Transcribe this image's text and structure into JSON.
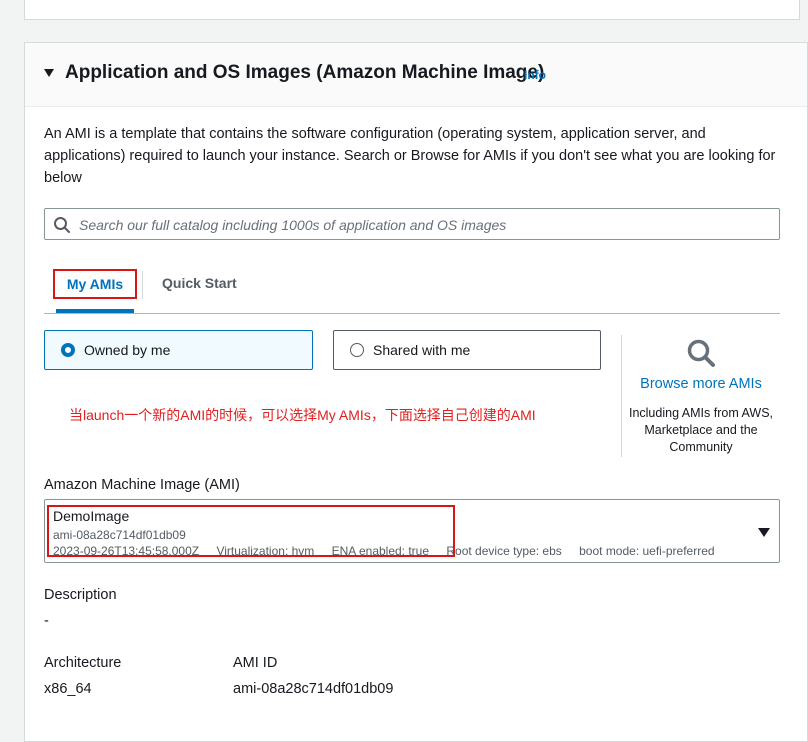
{
  "section": {
    "title": "Application and OS Images (Amazon Machine Image)",
    "info_link": "Info",
    "description": "An AMI is a template that contains the software configuration (operating system, application server, and applications) required to launch your instance. Search or Browse for AMIs if you don't see what you are looking for below"
  },
  "search": {
    "placeholder": "Search our full catalog including 1000s of application and OS images",
    "value": ""
  },
  "tabs": [
    {
      "label": "My AMIs",
      "selected": true
    },
    {
      "label": "Quick Start",
      "selected": false
    }
  ],
  "ownership": {
    "options": [
      {
        "label": "Owned by me",
        "selected": true
      },
      {
        "label": "Shared with me",
        "selected": false
      }
    ]
  },
  "browse": {
    "link": "Browse more AMIs",
    "note": "Including AMIs from AWS, Marketplace and the Community"
  },
  "annotation": "当launch一个新的AMI的时候，可以选择My AMIs，下面选择自己创建的AMI",
  "ami": {
    "label": "Amazon Machine Image (AMI)",
    "name": "DemoImage",
    "id": "ami-08a28c714df01db09",
    "created": "2023-09-26T13:45:58.000Z",
    "virtualization": "Virtualization: hvm",
    "ena": "ENA enabled: true",
    "root_device": "Root device type: ebs",
    "boot_mode": "boot mode: uefi-preferred"
  },
  "details": {
    "description_label": "Description",
    "description_value": "-",
    "architecture_label": "Architecture",
    "architecture_value": "x86_64",
    "ami_id_label": "AMI ID",
    "ami_id_value": "ami-08a28c714df01db09"
  },
  "colors": {
    "accent": "#0073bb",
    "annotation": "#e02020",
    "highlight_border": "#d91515"
  },
  "icons": {
    "section_toggle": "caret-down-icon",
    "search": "search-icon",
    "browse": "magnifier-icon",
    "dropdown": "chevron-down-icon"
  }
}
